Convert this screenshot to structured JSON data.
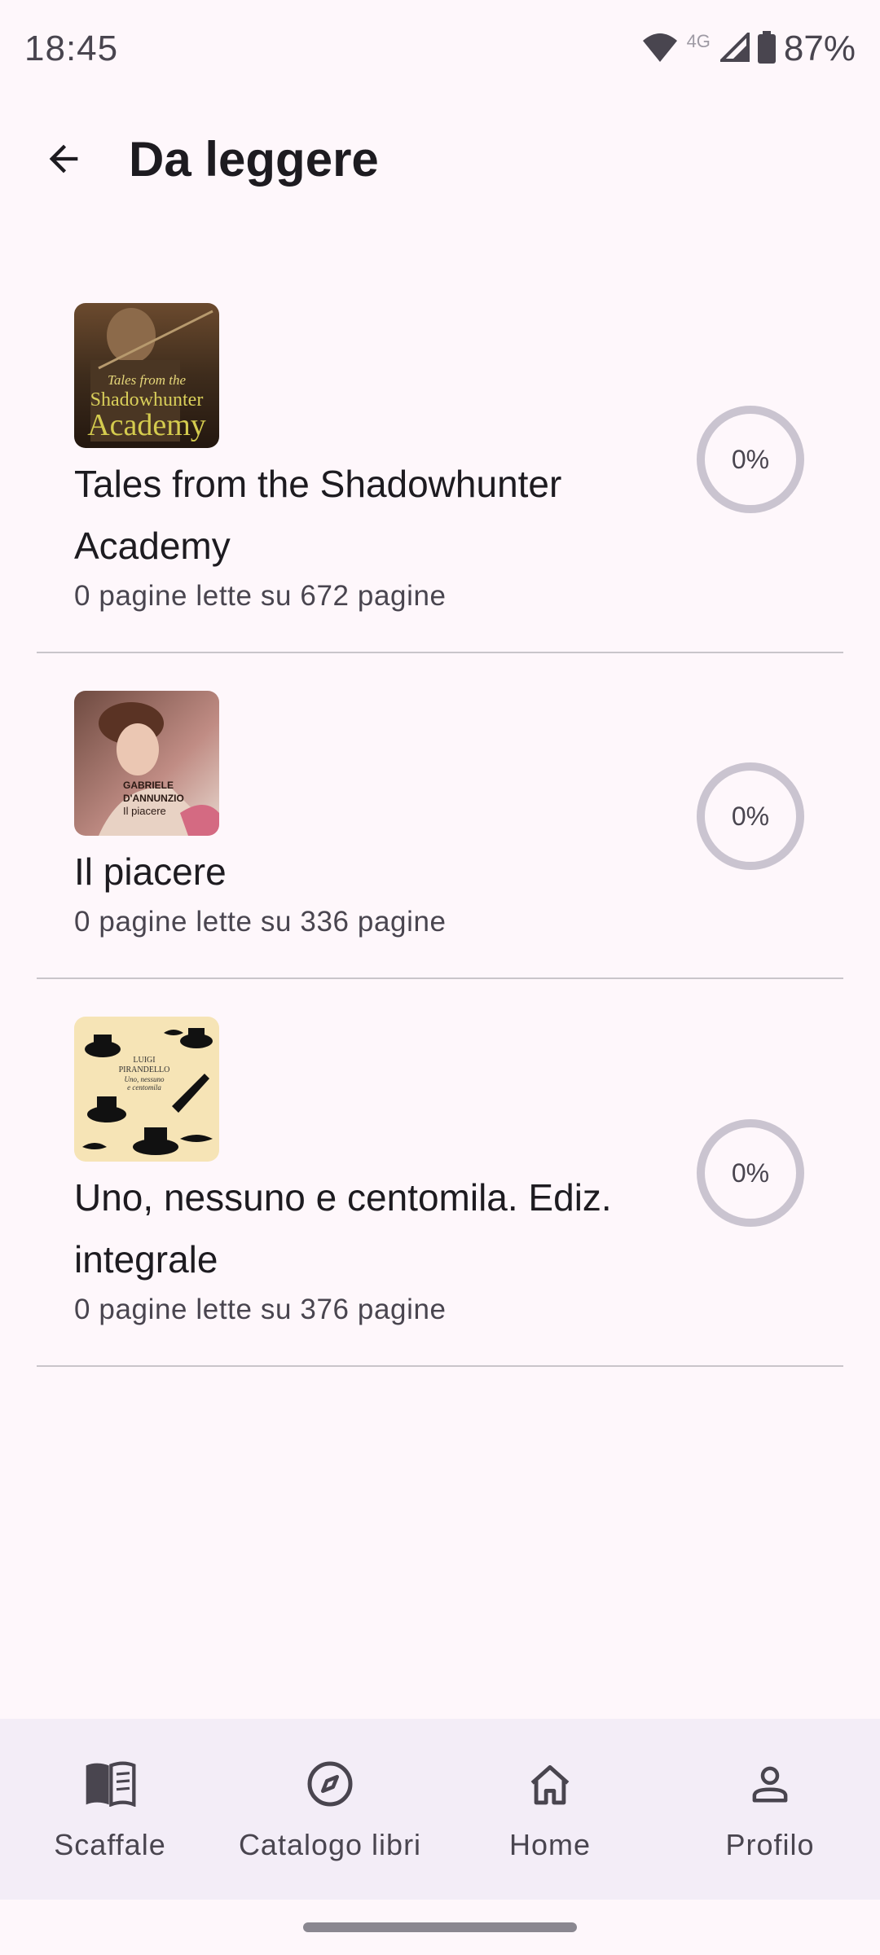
{
  "status_bar": {
    "time": "18:45",
    "network": "4G",
    "battery": "87%"
  },
  "app_bar": {
    "title": "Da leggere"
  },
  "books": [
    {
      "title": "Tales from the Shadowhunter Academy",
      "pages": "0 pagine lette su 672 pagine",
      "progress": "0%",
      "progress_value": 0,
      "cover_text": [
        "Tales from the",
        "Shadowhunter",
        "Academy"
      ]
    },
    {
      "title": "Il piacere",
      "pages": "0 pagine lette su 336 pagine",
      "progress": "0%",
      "progress_value": 0,
      "cover_text": [
        "GABRIELE",
        "D'ANNUNZIO",
        "Il piacere"
      ]
    },
    {
      "title": "Uno, nessuno e centomila. Ediz. integrale",
      "pages": "0 pagine lette su 376 pagine",
      "progress": "0%",
      "progress_value": 0,
      "cover_text": [
        "LUIGI",
        "PIRANDELLO",
        "Uno, nessuno",
        "e centomila"
      ]
    }
  ],
  "bottom_nav": {
    "items": [
      {
        "label": "Scaffale",
        "icon": "book-open-icon"
      },
      {
        "label": "Catalogo libri",
        "icon": "compass-icon"
      },
      {
        "label": "Home",
        "icon": "home-icon"
      },
      {
        "label": "Profilo",
        "icon": "person-icon"
      }
    ]
  },
  "colors": {
    "background": "#FEF7FB",
    "nav_background": "#F3EDF7",
    "progress_track": "#CAC4D0",
    "text_primary": "#1D1B20",
    "text_secondary": "#49454F"
  }
}
